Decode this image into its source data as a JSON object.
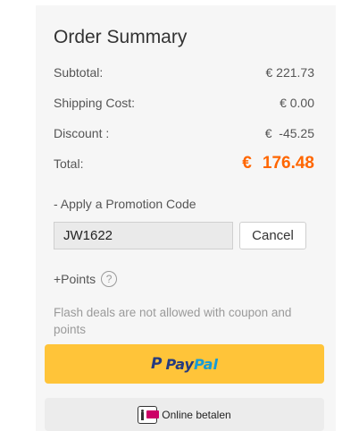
{
  "summary": {
    "title": "Order Summary",
    "subtotal_label": "Subtotal:",
    "subtotal_value": "€ 221.73",
    "shipping_label": "Shipping Cost:",
    "shipping_value": "€ 0.00",
    "discount_label": "Discount :",
    "discount_value": "€  -45.25",
    "total_label": "Total:",
    "total_currency": "€",
    "total_amount": "176.48"
  },
  "promo": {
    "label": "- Apply a Promotion Code",
    "code_value": "JW1622",
    "cancel_label": "Cancel"
  },
  "points": {
    "label": "+Points",
    "help_icon": "?"
  },
  "notice": "Flash deals are not allowed with coupon and points",
  "payment": {
    "paypal_pay": "Pay",
    "paypal_pal": "Pal",
    "paypal_mark": "P",
    "ideal_label": "Online betalen"
  },
  "colors": {
    "total_accent": "#ff6600",
    "paypal_button": "#ffc439",
    "paypal_dark": "#253b80",
    "paypal_light": "#179bd7"
  }
}
